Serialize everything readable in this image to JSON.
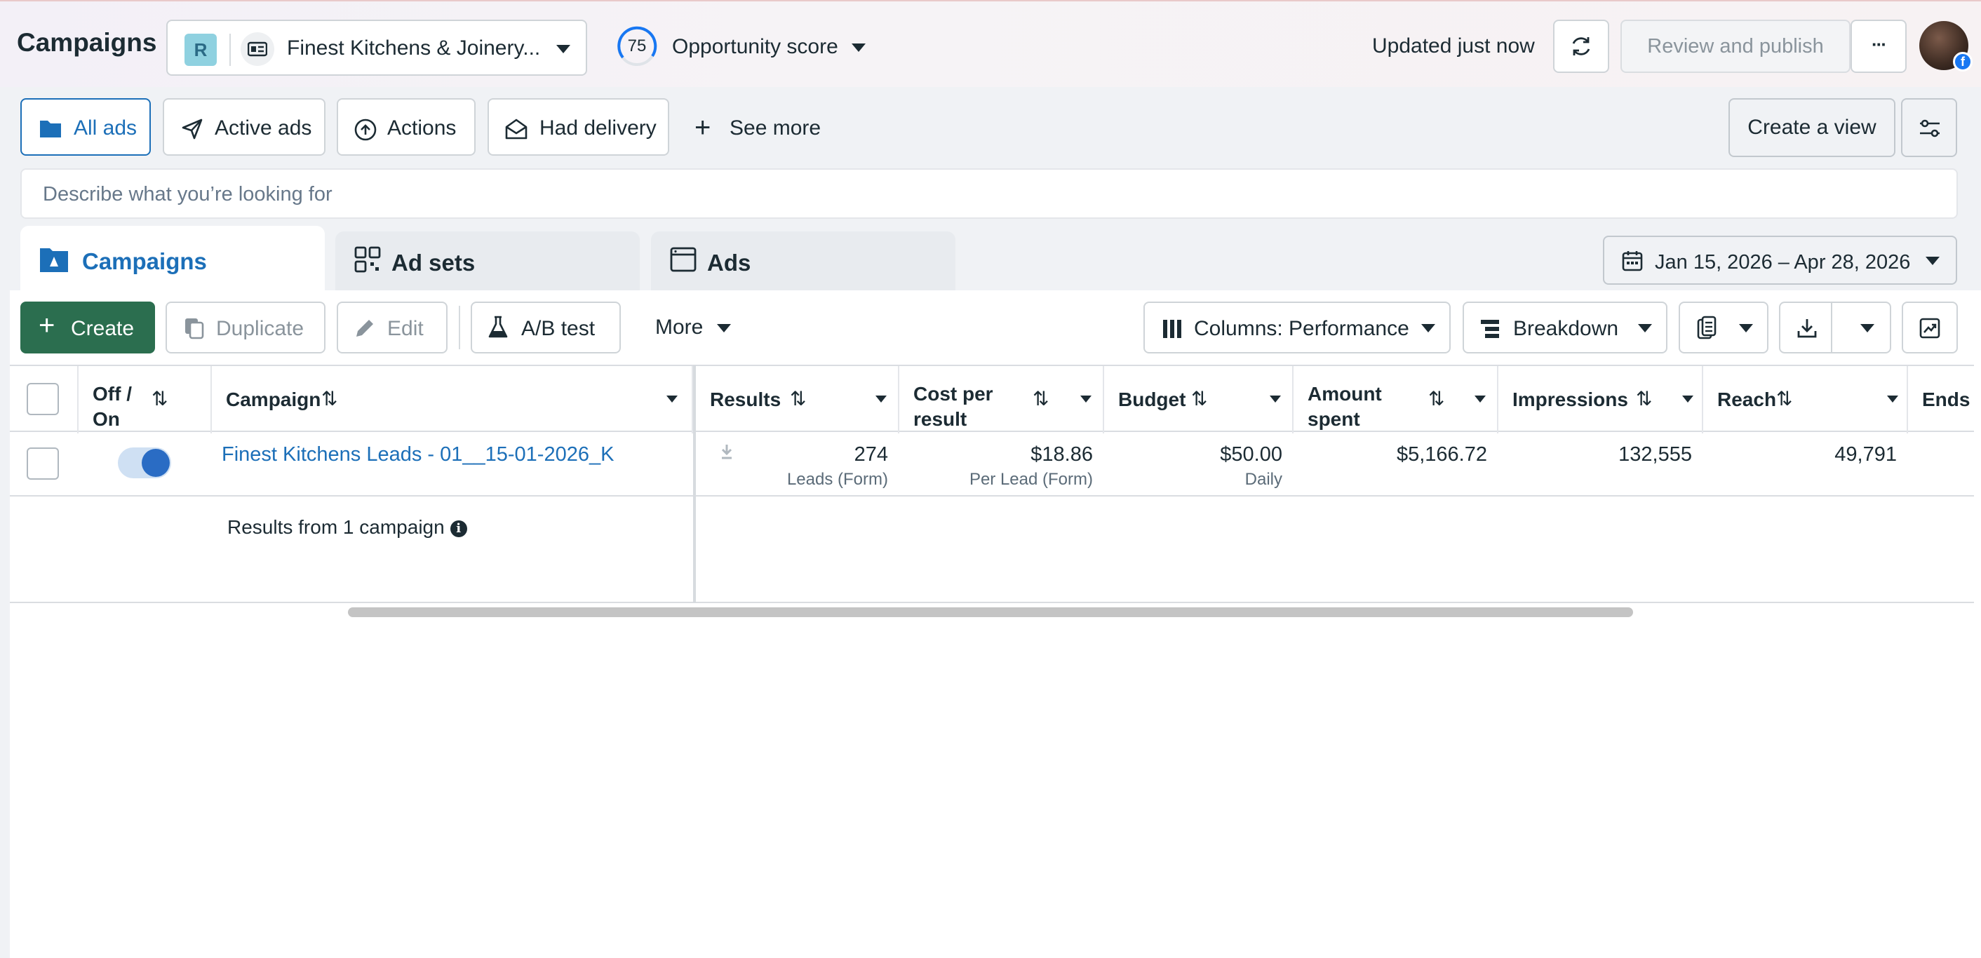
{
  "header": {
    "title": "Campaigns",
    "account": {
      "initial": "R",
      "name": "Finest Kitchens & Joinery..."
    },
    "opportunity": {
      "score": "75",
      "label": "Opportunity score"
    },
    "updated": "Updated just now",
    "review_label": "Review and publish",
    "more_label": "···"
  },
  "filters": {
    "all_ads": "All ads",
    "active_ads": "Active ads",
    "actions": "Actions",
    "had_delivery": "Had delivery",
    "see_more": "See more",
    "create_view": "Create a view"
  },
  "search": {
    "placeholder": "Describe what you’re looking for"
  },
  "tabs": {
    "campaigns": "Campaigns",
    "ad_sets": "Ad sets",
    "ads": "Ads"
  },
  "date_range": "Jan 15, 2026 – Apr 28, 2026",
  "toolbar": {
    "create": "Create",
    "duplicate": "Duplicate",
    "edit": "Edit",
    "ab_test": "A/B test",
    "more": "More",
    "columns": "Columns: Performance",
    "breakdown": "Breakdown"
  },
  "table": {
    "headers": {
      "off_on": "Off /\nOn",
      "campaign": "Campaign",
      "results": "Results",
      "cost_per_result": "Cost per\nresult",
      "budget": "Budget",
      "amount_spent": "Amount\nspent",
      "impressions": "Impressions",
      "reach": "Reach",
      "ends": "Ends"
    },
    "sort_glyph": "⇅",
    "rows": [
      {
        "campaign": "Finest Kitchens Leads - 01__15-01-2026_K",
        "results": "274",
        "results_sub": "Leads (Form)",
        "cost_per_result": "$18.86",
        "cost_per_result_sub": "Per Lead (Form)",
        "budget": "$50.00",
        "budget_sub": "Daily",
        "amount_spent": "$5,166.72",
        "impressions": "132,555",
        "reach": "49,791"
      }
    ],
    "summary": "Results from 1 campaign"
  }
}
